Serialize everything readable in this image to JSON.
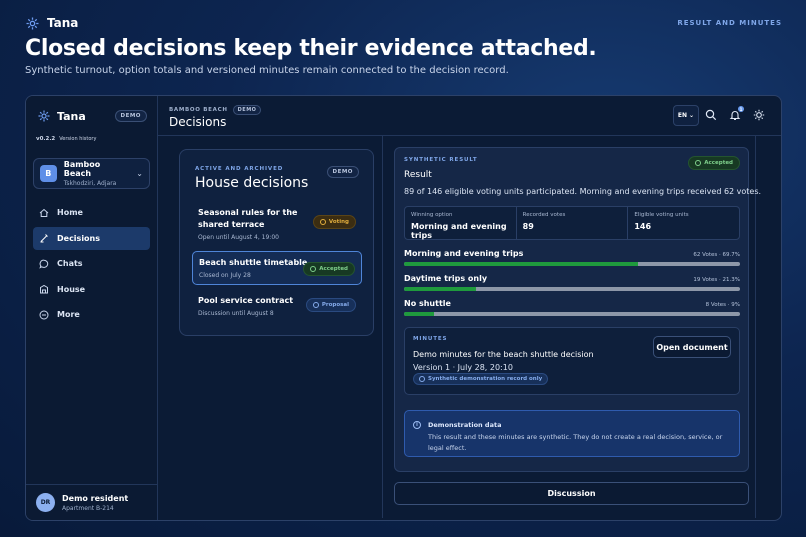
{
  "header": {
    "brand": "Tana",
    "section_label": "RESULT AND MINUTES",
    "title": "Closed decisions keep their evidence attached.",
    "subtitle": "Synthetic turnout, option totals and versioned minutes remain connected to the decision record."
  },
  "sidebar": {
    "brand": "Tana",
    "demo_badge": "DEMO",
    "version": "v0.2.2",
    "version_link": "Version history",
    "org": {
      "initial": "B",
      "name": "Bamboo Beach",
      "location": "Tskhodziri, Adjara"
    },
    "nav": [
      {
        "label": "Home",
        "icon": "home-icon",
        "active": false
      },
      {
        "label": "Decisions",
        "icon": "decisions-icon",
        "active": true
      },
      {
        "label": "Chats",
        "icon": "chat-icon",
        "active": false
      },
      {
        "label": "House",
        "icon": "building-icon",
        "active": false
      },
      {
        "label": "More",
        "icon": "more-icon",
        "active": false
      }
    ],
    "user": {
      "initials": "DR",
      "name": "Demo resident",
      "apartment": "Apartment B-214"
    }
  },
  "topbar": {
    "breadcrumb": "BAMBOO BEACH",
    "breadcrumb_badge": "DEMO",
    "title": "Decisions",
    "language": "EN",
    "notification_count": "1"
  },
  "decisions_panel": {
    "kicker": "ACTIVE AND ARCHIVED",
    "title": "House decisions",
    "badge": "DEMO",
    "items": [
      {
        "title": "Seasonal rules for the shared terrace",
        "meta": "Open until August 4, 19:00",
        "status": "Voting"
      },
      {
        "title": "Beach shuttle timetable",
        "meta": "Closed on July 28",
        "status": "Accepted"
      },
      {
        "title": "Pool service contract",
        "meta": "Discussion until August 8",
        "status": "Proposal"
      }
    ]
  },
  "result": {
    "kicker": "SYNTHETIC RESULT",
    "title": "Result",
    "status": "Accepted",
    "summary": "89 of 146 eligible voting units participated. Morning and evening trips received 62 votes.",
    "stats": [
      {
        "label": "Winning option",
        "value": "Morning and evening trips"
      },
      {
        "label": "Recorded votes",
        "value": "89"
      },
      {
        "label": "Eligible voting units",
        "value": "146"
      }
    ],
    "options": [
      {
        "name": "Morning and evening trips",
        "count": "62 Votes · 69.7%",
        "share": 0.697
      },
      {
        "name": "Daytime trips only",
        "count": "19 Votes · 21.3%",
        "share": 0.213
      },
      {
        "name": "No shuttle",
        "count": "8 Votes · 9%",
        "share": 0.09
      }
    ],
    "minutes": {
      "kicker": "MINUTES",
      "title": "Demo minutes for the beach shuttle decision",
      "version": "Version 1 · July 28, 20:10",
      "tag": "Synthetic demonstration record only",
      "open_button": "Open document"
    },
    "notice": {
      "title": "Demonstration data",
      "text": "This result and these minutes are synthetic. They do not create a real decision, service, or legal effect."
    }
  },
  "discussion_button": "Discussion",
  "colors": {
    "accent": "#7fa6e8",
    "bar_fill": "#1f9a3d",
    "bar_track": "#8d97a8"
  }
}
